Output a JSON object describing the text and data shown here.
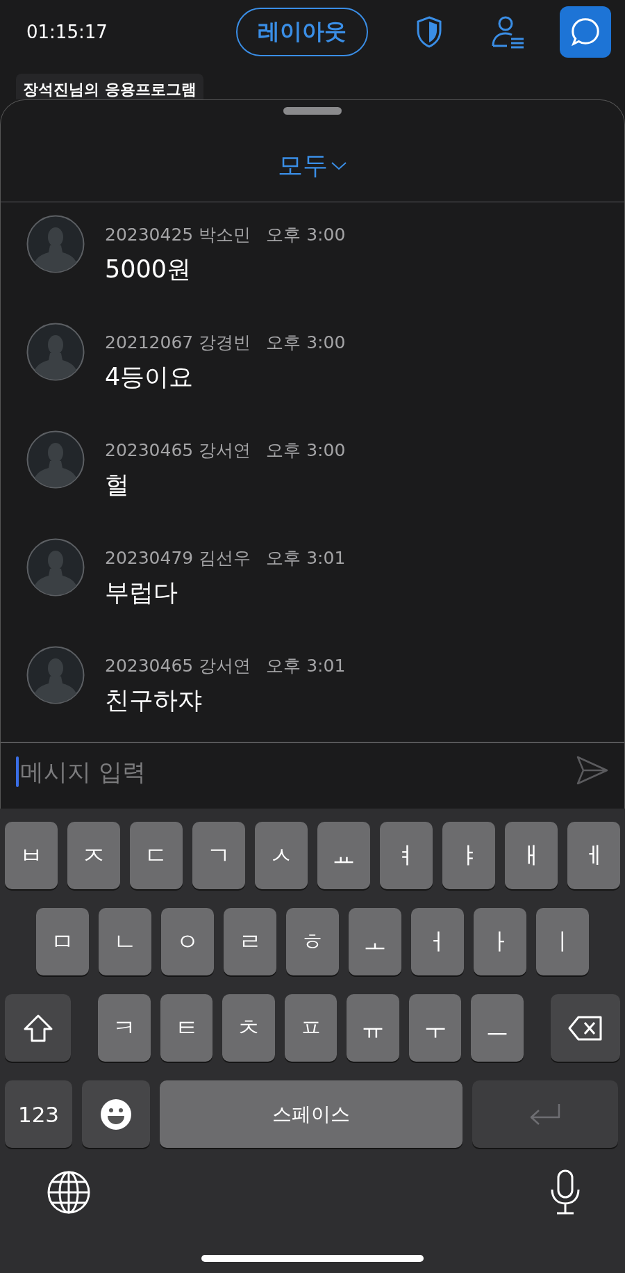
{
  "status_bar": {
    "time": "01:15:17"
  },
  "top_bar": {
    "layout_button": "레이아웃"
  },
  "app_tag": "장석진님의 응용프로그램",
  "chat_sheet": {
    "filter": "모두",
    "messages": [
      {
        "sender": "20230425 박소민",
        "time": "오후 3:00",
        "text": "5000원"
      },
      {
        "sender": "20212067 강경빈",
        "time": "오후 3:00",
        "text": "4등이요"
      },
      {
        "sender": "20230465 강서연",
        "time": "오후 3:00",
        "text": "헐"
      },
      {
        "sender": "20230479 김선우",
        "time": "오후 3:01",
        "text": "부럽다"
      },
      {
        "sender": "20230465 강서연",
        "time": "오후 3:01",
        "text": "친구하쟈"
      }
    ],
    "input": {
      "placeholder": "메시지 입력"
    }
  },
  "keyboard": {
    "rows": [
      {
        "keys": [
          {
            "kind": "letter",
            "label": "ㅂ"
          },
          {
            "kind": "letter",
            "label": "ㅈ"
          },
          {
            "kind": "letter",
            "label": "ㄷ"
          },
          {
            "kind": "letter",
            "label": "ㄱ"
          },
          {
            "kind": "letter",
            "label": "ㅅ"
          },
          {
            "kind": "letter",
            "label": "ㅛ"
          },
          {
            "kind": "letter",
            "label": "ㅕ"
          },
          {
            "kind": "letter",
            "label": "ㅑ"
          },
          {
            "kind": "letter",
            "label": "ㅐ"
          },
          {
            "kind": "letter",
            "label": "ㅔ"
          }
        ]
      },
      {
        "keys": [
          {
            "kind": "letter",
            "label": "ㅁ"
          },
          {
            "kind": "letter",
            "label": "ㄴ"
          },
          {
            "kind": "letter",
            "label": "ㅇ"
          },
          {
            "kind": "letter",
            "label": "ㄹ"
          },
          {
            "kind": "letter",
            "label": "ㅎ"
          },
          {
            "kind": "letter",
            "label": "ㅗ"
          },
          {
            "kind": "letter",
            "label": "ㅓ"
          },
          {
            "kind": "letter",
            "label": "ㅏ"
          },
          {
            "kind": "letter",
            "label": "ㅣ"
          }
        ]
      },
      {
        "keys": [
          {
            "kind": "shift"
          },
          {
            "kind": "letter",
            "label": "ㅋ"
          },
          {
            "kind": "letter",
            "label": "ㅌ"
          },
          {
            "kind": "letter",
            "label": "ㅊ"
          },
          {
            "kind": "letter",
            "label": "ㅍ"
          },
          {
            "kind": "letter",
            "label": "ㅠ"
          },
          {
            "kind": "letter",
            "label": "ㅜ"
          },
          {
            "kind": "letter",
            "label": "ㅡ"
          },
          {
            "kind": "delete"
          }
        ]
      },
      {
        "keys": [
          {
            "kind": "numbers",
            "label": "123"
          },
          {
            "kind": "emoji"
          },
          {
            "kind": "space",
            "label": "스페이스"
          },
          {
            "kind": "return"
          }
        ]
      }
    ]
  }
}
